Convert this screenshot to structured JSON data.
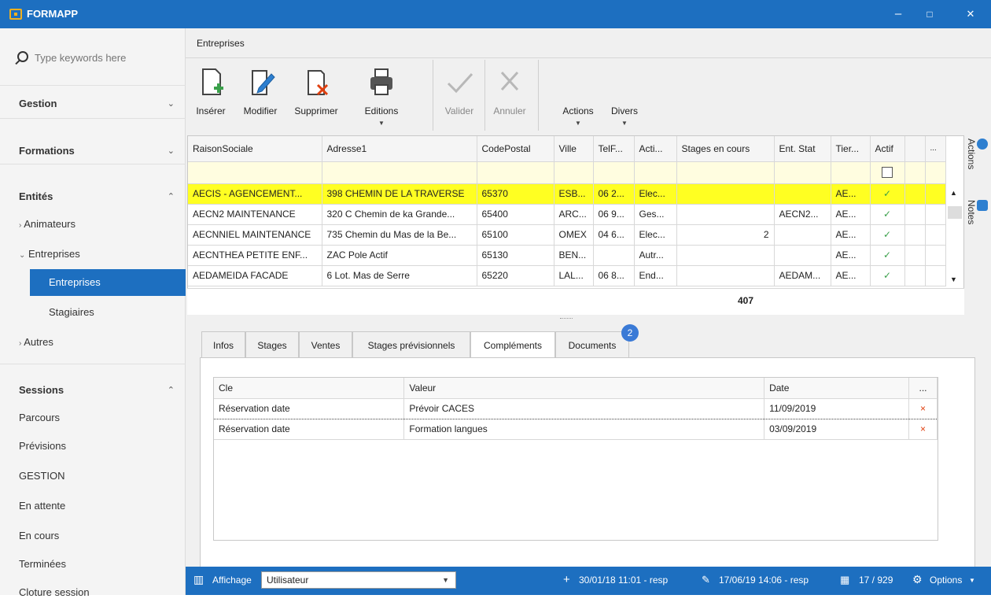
{
  "window": {
    "title": "FORMAPP",
    "min": "–",
    "max": "□",
    "close": "✕"
  },
  "sidebar": {
    "search_placeholder": "Type keywords here",
    "groups": {
      "gestion": "Gestion",
      "formations": "Formations",
      "entites": "Entités",
      "sessions": "Sessions"
    },
    "items": {
      "animateurs": "Animateurs",
      "entreprises": "Entreprises",
      "entreprises_sub": "Entreprises",
      "stagiaires": "Stagiaires",
      "autres": "Autres",
      "parcours": "Parcours",
      "previsions": "Prévisions",
      "gestion2": "GESTION",
      "attente": "En attente",
      "encours": "En cours",
      "terminees": "Terminées",
      "cloture": "Cloture session"
    }
  },
  "header": {
    "title": "Entreprises"
  },
  "ribbon": {
    "inserer": "Insérer",
    "modifier": "Modifier",
    "supprimer": "Supprimer",
    "editions": "Editions",
    "valider": "Valider",
    "annuler": "Annuler",
    "actions": "Actions",
    "divers": "Divers"
  },
  "grid": {
    "columns": [
      "RaisonSociale",
      "Adresse1",
      "CodePostal",
      "Ville",
      "TelF...",
      "Acti...",
      "Stages en cours",
      "Ent. Stat",
      "Tier...",
      "Actif",
      "",
      "..."
    ],
    "rows": [
      [
        "AECIS - AGENCEMENT...",
        "398 CHEMIN DE LA TRAVERSE",
        "65370",
        "ESB...",
        "06 2...",
        "Elec...",
        "",
        "",
        "AE...",
        "✓"
      ],
      [
        "AECN2 MAINTENANCE",
        "320 C Chemin de ka Grande...",
        "65400",
        "ARC...",
        "06 9...",
        "Ges...",
        "",
        "AECN2...",
        "AE...",
        "✓"
      ],
      [
        "AECNNIEL MAINTENANCE",
        "735 Chemin du Mas de la Be...",
        "65100",
        "OMEX",
        "04 6...",
        "Elec...",
        "2",
        "",
        "AE...",
        "✓"
      ],
      [
        "AECNTHEA PETITE ENF...",
        "ZAC Pole Actif",
        "65130",
        "BEN...",
        "",
        "Autr...",
        "",
        "",
        "AE...",
        "✓"
      ],
      [
        "AEDAMEIDA FACADE",
        "6 Lot. Mas de Serre",
        "65220",
        "LAL...",
        "06 8...",
        "End...",
        "",
        "AEDAM...",
        "AE...",
        "✓"
      ]
    ],
    "total": "407"
  },
  "rightpanel": {
    "actions": "Actions",
    "notes": "Notes"
  },
  "tabs": [
    "Infos",
    "Stages",
    "Ventes",
    "Stages prévisionnels",
    "Compléments",
    "Documents"
  ],
  "documents_badge": "2",
  "complements": {
    "columns": [
      "Cle",
      "Valeur",
      "Date",
      "..."
    ],
    "rows": [
      [
        "Réservation date",
        "Prévoir CACES",
        "11/09/2019",
        "×"
      ],
      [
        "Réservation date",
        "Formation langues",
        "03/09/2019",
        "×"
      ]
    ]
  },
  "statusbar": {
    "affichage": "Affichage",
    "affichage_value": "Utilisateur",
    "created": "30/01/18 11:01 - resp",
    "modified": "17/06/19 14:06 - resp",
    "records": "17 / 929",
    "options": "Options"
  },
  "colors": {
    "accent": "#1d6fc0",
    "selected_row": "#ffff22",
    "check": "#3aa04a",
    "delete": "#e04010"
  }
}
